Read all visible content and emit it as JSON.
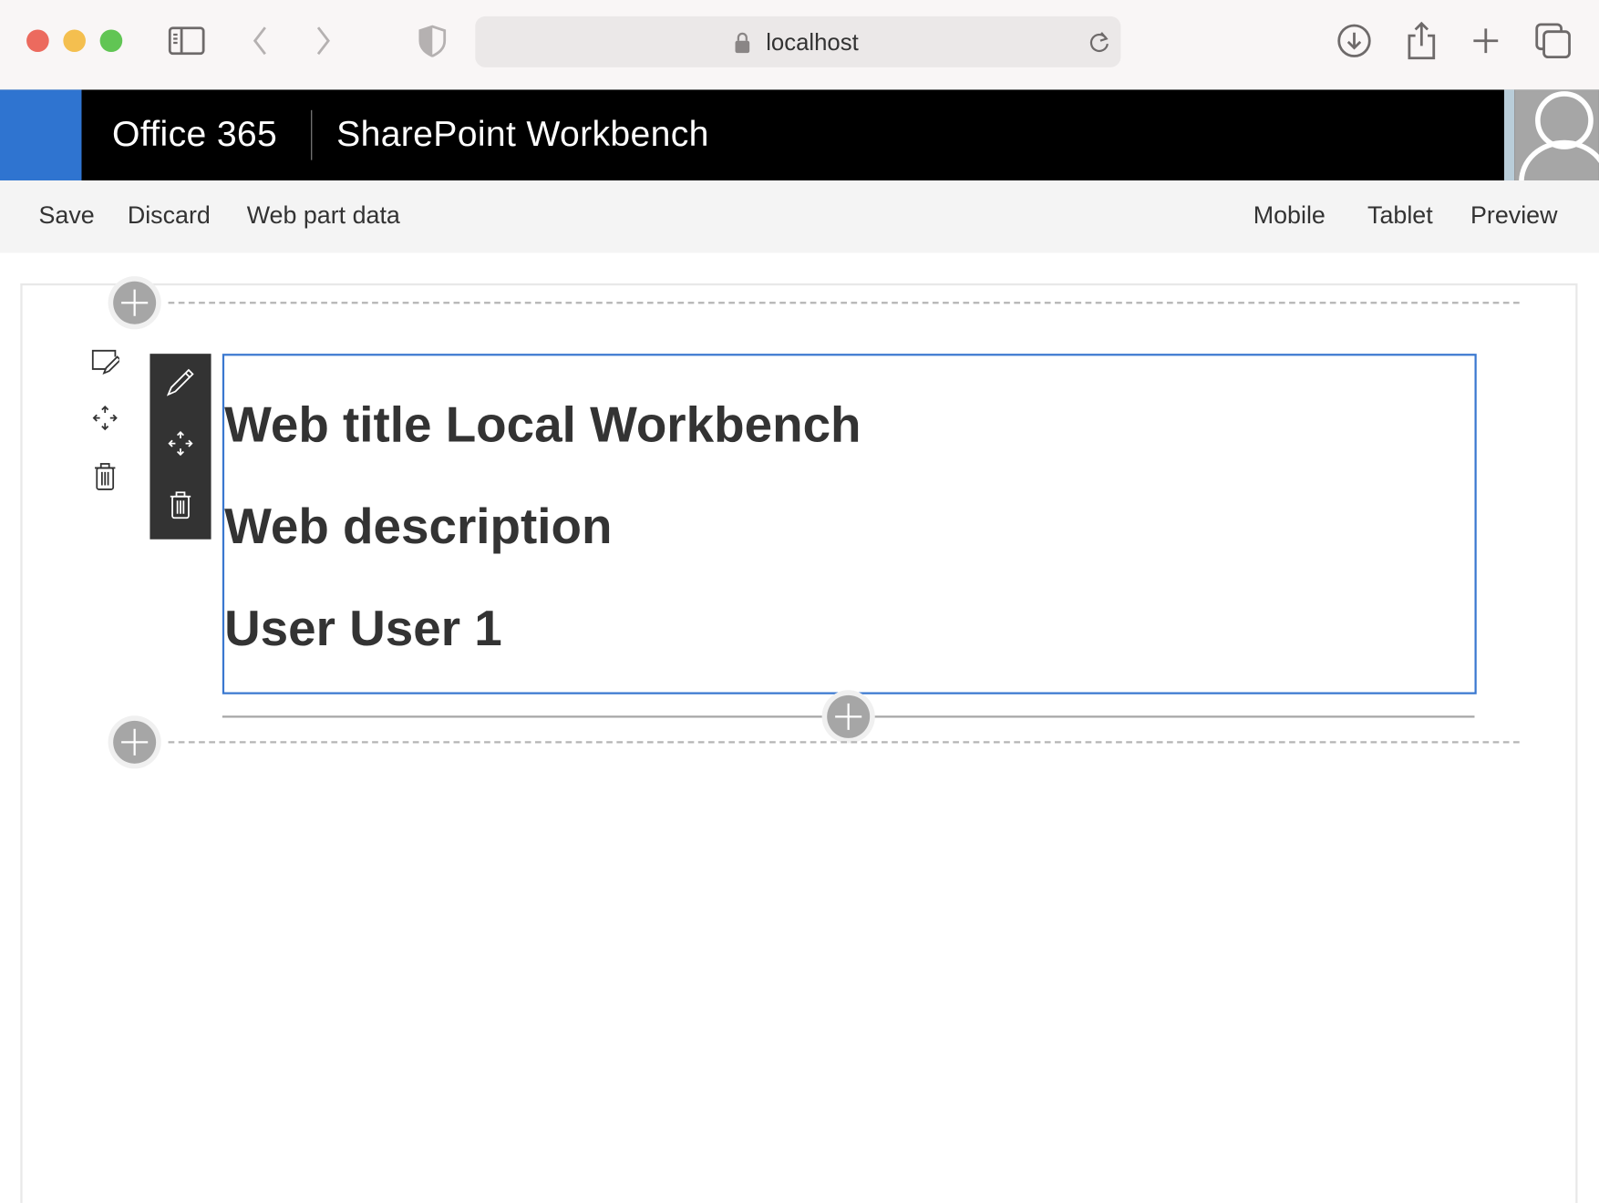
{
  "browser": {
    "url": "localhost"
  },
  "header": {
    "app_name": "Office 365",
    "product_name": "SharePoint Workbench"
  },
  "commandbar": {
    "left": [
      "Save",
      "Discard",
      "Web part data"
    ],
    "right": [
      "Mobile",
      "Tablet",
      "Preview"
    ]
  },
  "webpart": {
    "lines": [
      "Web title Local Workbench",
      "Web description",
      "User User 1"
    ]
  },
  "colors": {
    "brand": "#2f74d0",
    "header": "#000000",
    "selection": "#3a78d0",
    "toolbar": "#333333"
  }
}
